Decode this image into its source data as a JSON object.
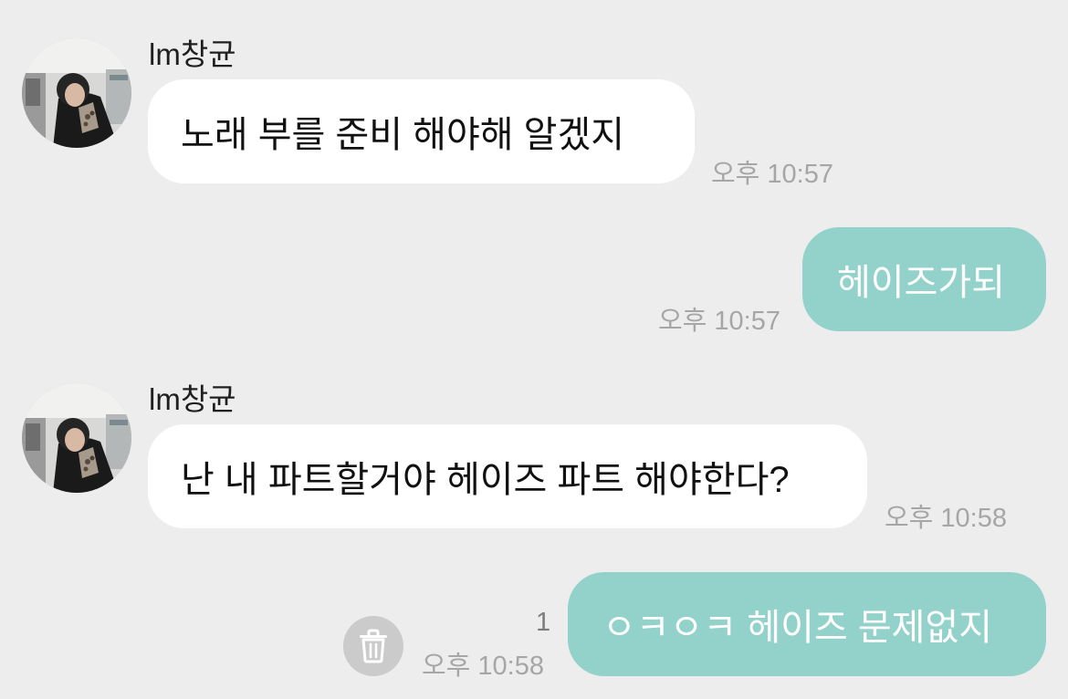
{
  "colors": {
    "background": "#ededed",
    "incoming_bubble": "#ffffff",
    "outgoing_bubble": "#93d2ca",
    "timestamp": "#a6a6a6"
  },
  "messages": [
    {
      "direction": "incoming",
      "sender": "lm창균",
      "text": "노래 부를 준비 해야해 알겠지",
      "time": "오후 10:57"
    },
    {
      "direction": "outgoing",
      "text": "헤이즈가되",
      "time": "오후 10:57"
    },
    {
      "direction": "incoming",
      "sender": "lm창균",
      "text": "난 내 파트할거야 헤이즈 파트 해야한다?",
      "time": "오후 10:58"
    },
    {
      "direction": "outgoing",
      "text": "ㅇㅋㅇㅋ 헤이즈 문제없지",
      "time": "오후 10:58",
      "unread_count": "1",
      "action_icon": "trash-icon"
    }
  ]
}
